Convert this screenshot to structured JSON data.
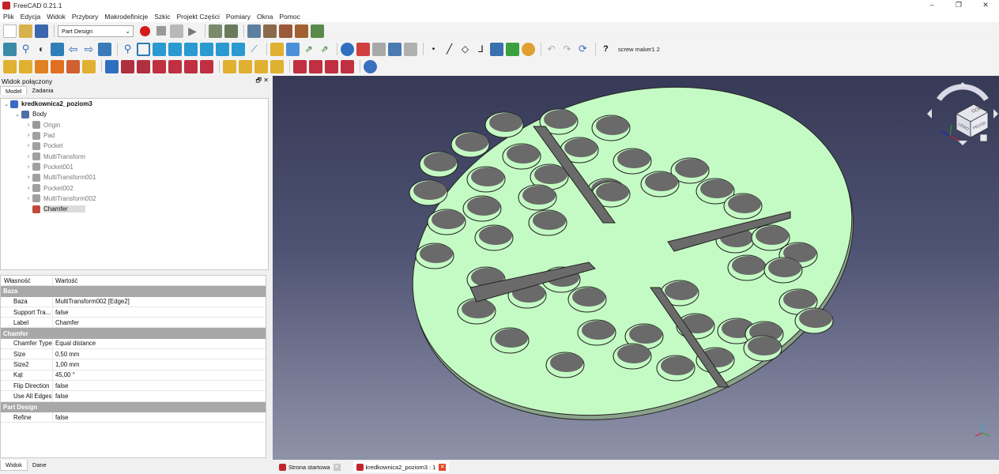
{
  "window": {
    "title": "FreeCAD 0.21.1",
    "min": "–",
    "max": "❐",
    "close": "✕"
  },
  "menu": [
    "Plik",
    "Edycja",
    "Widok",
    "Przybory",
    "Makrodefinicje",
    "Szkic",
    "Projekt Części",
    "Pomiary",
    "Okna",
    "Pomoc"
  ],
  "toolbar": {
    "workbench": "Part Design",
    "macro_label": "screw maker1 2"
  },
  "left_panel": {
    "title": "Widok połączony",
    "tabs": [
      "Model",
      "Zadania"
    ],
    "tree": [
      {
        "label": "kredkownica2_poziom3",
        "level": 0,
        "expander": "⌄",
        "bold": true,
        "icon_color": "#3b6cc4"
      },
      {
        "label": "Body",
        "level": 1,
        "expander": "⌄",
        "icon_color": "#4f6ea8"
      },
      {
        "label": "Origin",
        "level": 2,
        "expander": "›",
        "faded": true,
        "icon_color": "#999999"
      },
      {
        "label": "Pad",
        "level": 2,
        "expander": "›",
        "faded": true,
        "icon_color": "#a0a0a0"
      },
      {
        "label": "Pocket",
        "level": 2,
        "expander": "›",
        "faded": true,
        "icon_color": "#a0a0a0"
      },
      {
        "label": "MultiTransform",
        "level": 2,
        "expander": "›",
        "faded": true,
        "icon_color": "#a0a0a0"
      },
      {
        "label": "Pocket001",
        "level": 2,
        "expander": "›",
        "faded": true,
        "icon_color": "#a0a0a0"
      },
      {
        "label": "MultiTransform001",
        "level": 2,
        "expander": "›",
        "faded": true,
        "icon_color": "#a0a0a0"
      },
      {
        "label": "Pocket002",
        "level": 2,
        "expander": "›",
        "faded": true,
        "icon_color": "#a0a0a0"
      },
      {
        "label": "MultiTransform002",
        "level": 2,
        "expander": "›",
        "faded": true,
        "icon_color": "#a0a0a0"
      },
      {
        "label": "Chamfer",
        "level": 2,
        "expander": "",
        "selected": true,
        "icon_color": "#c04a3a"
      }
    ]
  },
  "properties": {
    "headers": {
      "key": "Własność",
      "value": "Wartość"
    },
    "groups": [
      {
        "name": "Baza",
        "rows": [
          {
            "k": "Baza",
            "v": "MultiTransform002 [Edge2]"
          },
          {
            "k": "Support Tra...",
            "v": "false"
          },
          {
            "k": "Label",
            "v": "Chamfer"
          }
        ]
      },
      {
        "name": "Chamfer",
        "rows": [
          {
            "k": "Chamfer Type",
            "v": "Equal distance"
          },
          {
            "k": "Size",
            "v": "0,50 mm"
          },
          {
            "k": "Size2",
            "v": "1,00 mm"
          },
          {
            "k": "Kąt",
            "v": "45,00 °"
          },
          {
            "k": "Flip Direction",
            "v": "false"
          },
          {
            "k": "Use All Edges",
            "v": "false"
          }
        ]
      },
      {
        "name": "Part Design",
        "rows": [
          {
            "k": "Refine",
            "v": "false"
          }
        ]
      }
    ]
  },
  "bottom_tabs": [
    "Widok",
    "Dane"
  ],
  "doc_tabs": [
    {
      "label": "Strona startowa",
      "active": false
    },
    {
      "label": "kredkownica2_poziom3 : 1",
      "active": true
    }
  ],
  "navcube": {
    "top_label": "GÓRA",
    "left_label": "LEWO",
    "front_label": "PRZÓD"
  },
  "colors": {
    "part_face": "#c4fbc4",
    "part_side": "#8aa28a",
    "hole": "#6a6a6a",
    "bg_top": "#363a56",
    "bg_bottom": "#8f93a9"
  }
}
